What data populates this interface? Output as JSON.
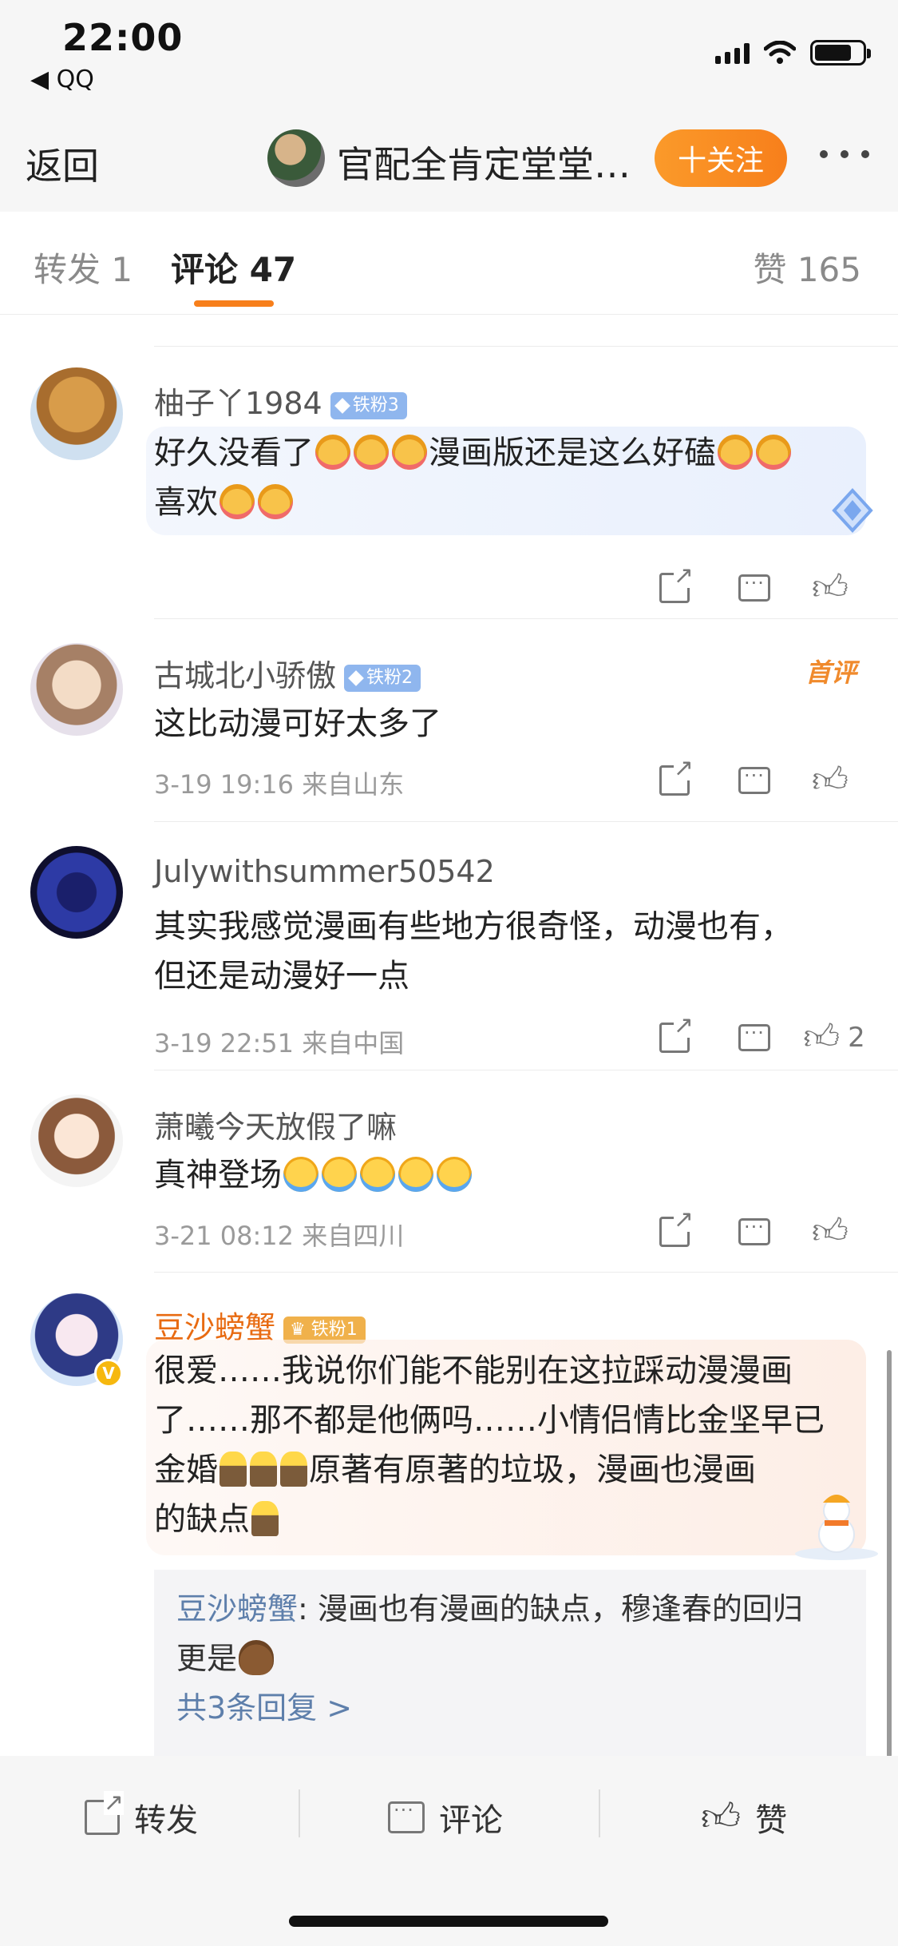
{
  "status_bar": {
    "time": "22:00",
    "back_app": "◀ QQ"
  },
  "nav": {
    "back_label": "返回",
    "title": "官配全肯定堂堂…",
    "follow_label": "十关注"
  },
  "tabs": {
    "repost": "转发 1",
    "comments": "评论 47",
    "likes": "赞 165"
  },
  "comments": [
    {
      "username": "柚子丫1984",
      "fan_badge": "铁粉3",
      "line1": "好久没看了",
      "mid1": "漫画版还是这么好磕",
      "line2": "喜欢",
      "meta": "",
      "like_count": ""
    },
    {
      "username": "古城北小骄傲",
      "fan_badge": "铁粉2",
      "text": "这比动漫可好太多了",
      "meta": "3-19 19:16  来自山东",
      "first_badge": "首评",
      "like_count": ""
    },
    {
      "username": "Julywithsummer50542",
      "text1": "其实我感觉漫画有些地方很奇怪，动漫也有，",
      "text2": "但还是动漫好一点",
      "meta": "3-19 22:51  来自中国",
      "like_count": "2"
    },
    {
      "username": "萧曦今天放假了嘛",
      "text": "真神登场",
      "meta": "3-21 08:12  来自四川",
      "like_count": ""
    },
    {
      "username": "豆沙螃蟹",
      "fan_badge": "铁粉1",
      "text1": "很爱……我说你们能不能别在这拉踩动漫漫画",
      "text2": "了……那不都是他俩吗……小情侣情比金坚早已",
      "text3a": "金婚",
      "text3b": "原著有原著的垃圾，漫画也漫画",
      "text4": "的缺点",
      "reply": {
        "user": "豆沙螃蟹",
        "text1": ": 漫画也有漫画的缺点，穆逢春的回归",
        "text2": "更是",
        "more": "共3条回复 >"
      }
    }
  ],
  "bottom_bar": {
    "repost": "转发",
    "comment": "评论",
    "like": "赞"
  },
  "colors": {
    "accent": "#f77f1b",
    "link": "#5e7fab",
    "fan_badge": "#8fb6ee"
  }
}
